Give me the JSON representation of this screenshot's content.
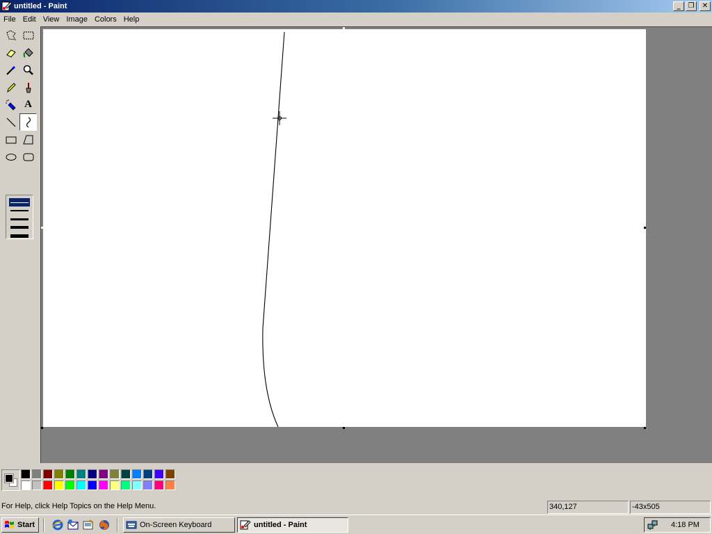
{
  "window": {
    "title": "untitled - Paint",
    "icon": "paint-app-icon",
    "controls": [
      "minimize",
      "restore",
      "close"
    ]
  },
  "menubar": {
    "items": [
      "File",
      "Edit",
      "View",
      "Image",
      "Colors",
      "Help"
    ]
  },
  "toolbox": {
    "tools": [
      {
        "name": "free-form-select",
        "icon": "free-form-select-icon"
      },
      {
        "name": "select",
        "icon": "rect-select-icon"
      },
      {
        "name": "eraser",
        "icon": "eraser-icon"
      },
      {
        "name": "fill-with-color",
        "icon": "paint-bucket-icon"
      },
      {
        "name": "pick-color",
        "icon": "eyedropper-icon"
      },
      {
        "name": "magnifier",
        "icon": "magnifier-icon"
      },
      {
        "name": "pencil",
        "icon": "pencil-icon"
      },
      {
        "name": "brush",
        "icon": "brush-icon"
      },
      {
        "name": "airbrush",
        "icon": "airbrush-icon"
      },
      {
        "name": "text",
        "icon": "text-icon",
        "glyph": "A"
      },
      {
        "name": "line",
        "icon": "line-icon"
      },
      {
        "name": "curve",
        "icon": "curve-icon",
        "selected": true
      },
      {
        "name": "rectangle",
        "icon": "rectangle-icon"
      },
      {
        "name": "polygon",
        "icon": "polygon-icon"
      },
      {
        "name": "ellipse",
        "icon": "ellipse-icon"
      },
      {
        "name": "rounded-rectangle",
        "icon": "rounded-rectangle-icon"
      }
    ],
    "line_widths": [
      1,
      2,
      3,
      4,
      5
    ],
    "selected_width": 1
  },
  "palette": {
    "foreground": "#000000",
    "background": "#ffffff",
    "top_row": [
      "#000000",
      "#808080",
      "#800000",
      "#808000",
      "#008000",
      "#008080",
      "#000080",
      "#800080",
      "#808040",
      "#004040",
      "#0080ff",
      "#004080",
      "#4000ff",
      "#804000"
    ],
    "bottom_row": [
      "#ffffff",
      "#c0c0c0",
      "#ff0000",
      "#ffff00",
      "#00ff00",
      "#00ffff",
      "#0000ff",
      "#ff00ff",
      "#ffff80",
      "#00ff80",
      "#80ffff",
      "#8080ff",
      "#ff0080",
      "#ff8040"
    ]
  },
  "statusbar": {
    "help_text": "For Help, click Help Topics on the Help Menu.",
    "cursor_position": "340,127",
    "selection_size": "-43x505"
  },
  "taskbar": {
    "start_label": "Start",
    "quick_launch": [
      "internet-explorer-icon",
      "outlook-express-icon",
      "show-desktop-icon",
      "firefox-icon"
    ],
    "tasks": [
      {
        "label": "On-Screen Keyboard",
        "icon": "keyboard-icon",
        "active": false
      },
      {
        "label": "untitled - Paint",
        "icon": "paint-app-icon",
        "active": true
      }
    ],
    "tray_icons": [
      "network-icon"
    ],
    "clock": "4:18 PM"
  }
}
